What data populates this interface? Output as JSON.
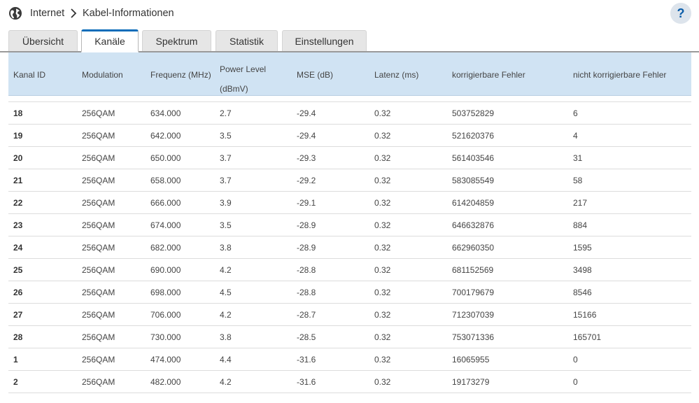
{
  "breadcrumb": {
    "section": "Internet",
    "page": "Kabel-Informationen"
  },
  "help_label": "?",
  "tabs": [
    {
      "label": "Übersicht",
      "active": false
    },
    {
      "label": "Kanäle",
      "active": true
    },
    {
      "label": "Spektrum",
      "active": false
    },
    {
      "label": "Statistik",
      "active": false
    },
    {
      "label": "Einstellungen",
      "active": false
    }
  ],
  "table": {
    "headers": {
      "kanal_id": "Kanal ID",
      "modulation": "Modulation",
      "frequenz": "Frequenz (MHz)",
      "power_level_1": "Power Level",
      "power_level_2": "(dBmV)",
      "mse": "MSE (dB)",
      "latenz": "Latenz (ms)",
      "korrigierbar": "korrigierbare Fehler",
      "nicht_korrigierbar": "nicht korrigierbare Fehler"
    },
    "rows": [
      {
        "id": "18",
        "mod": "256QAM",
        "freq": "634.000",
        "power": "2.7",
        "mse": "-29.4",
        "lat": "0.32",
        "korr": "503752829",
        "nkorr": "6"
      },
      {
        "id": "19",
        "mod": "256QAM",
        "freq": "642.000",
        "power": "3.5",
        "mse": "-29.4",
        "lat": "0.32",
        "korr": "521620376",
        "nkorr": "4"
      },
      {
        "id": "20",
        "mod": "256QAM",
        "freq": "650.000",
        "power": "3.7",
        "mse": "-29.3",
        "lat": "0.32",
        "korr": "561403546",
        "nkorr": "31"
      },
      {
        "id": "21",
        "mod": "256QAM",
        "freq": "658.000",
        "power": "3.7",
        "mse": "-29.2",
        "lat": "0.32",
        "korr": "583085549",
        "nkorr": "58"
      },
      {
        "id": "22",
        "mod": "256QAM",
        "freq": "666.000",
        "power": "3.9",
        "mse": "-29.1",
        "lat": "0.32",
        "korr": "614204859",
        "nkorr": "217"
      },
      {
        "id": "23",
        "mod": "256QAM",
        "freq": "674.000",
        "power": "3.5",
        "mse": "-28.9",
        "lat": "0.32",
        "korr": "646632876",
        "nkorr": "884"
      },
      {
        "id": "24",
        "mod": "256QAM",
        "freq": "682.000",
        "power": "3.8",
        "mse": "-28.9",
        "lat": "0.32",
        "korr": "662960350",
        "nkorr": "1595"
      },
      {
        "id": "25",
        "mod": "256QAM",
        "freq": "690.000",
        "power": "4.2",
        "mse": "-28.8",
        "lat": "0.32",
        "korr": "681152569",
        "nkorr": "3498"
      },
      {
        "id": "26",
        "mod": "256QAM",
        "freq": "698.000",
        "power": "4.5",
        "mse": "-28.8",
        "lat": "0.32",
        "korr": "700179679",
        "nkorr": "8546"
      },
      {
        "id": "27",
        "mod": "256QAM",
        "freq": "706.000",
        "power": "4.2",
        "mse": "-28.7",
        "lat": "0.32",
        "korr": "712307039",
        "nkorr": "15166"
      },
      {
        "id": "28",
        "mod": "256QAM",
        "freq": "730.000",
        "power": "3.8",
        "mse": "-28.5",
        "lat": "0.32",
        "korr": "753071336",
        "nkorr": "165701"
      },
      {
        "id": "1",
        "mod": "256QAM",
        "freq": "474.000",
        "power": "4.4",
        "mse": "-31.6",
        "lat": "0.32",
        "korr": "16065955",
        "nkorr": "0"
      },
      {
        "id": "2",
        "mod": "256QAM",
        "freq": "482.000",
        "power": "4.2",
        "mse": "-31.6",
        "lat": "0.32",
        "korr": "19173279",
        "nkorr": "0"
      }
    ]
  },
  "colors": {
    "accent": "#0a6cb9",
    "header_bg": "#d0e3f3",
    "tab_bg": "#e6e6e6"
  }
}
